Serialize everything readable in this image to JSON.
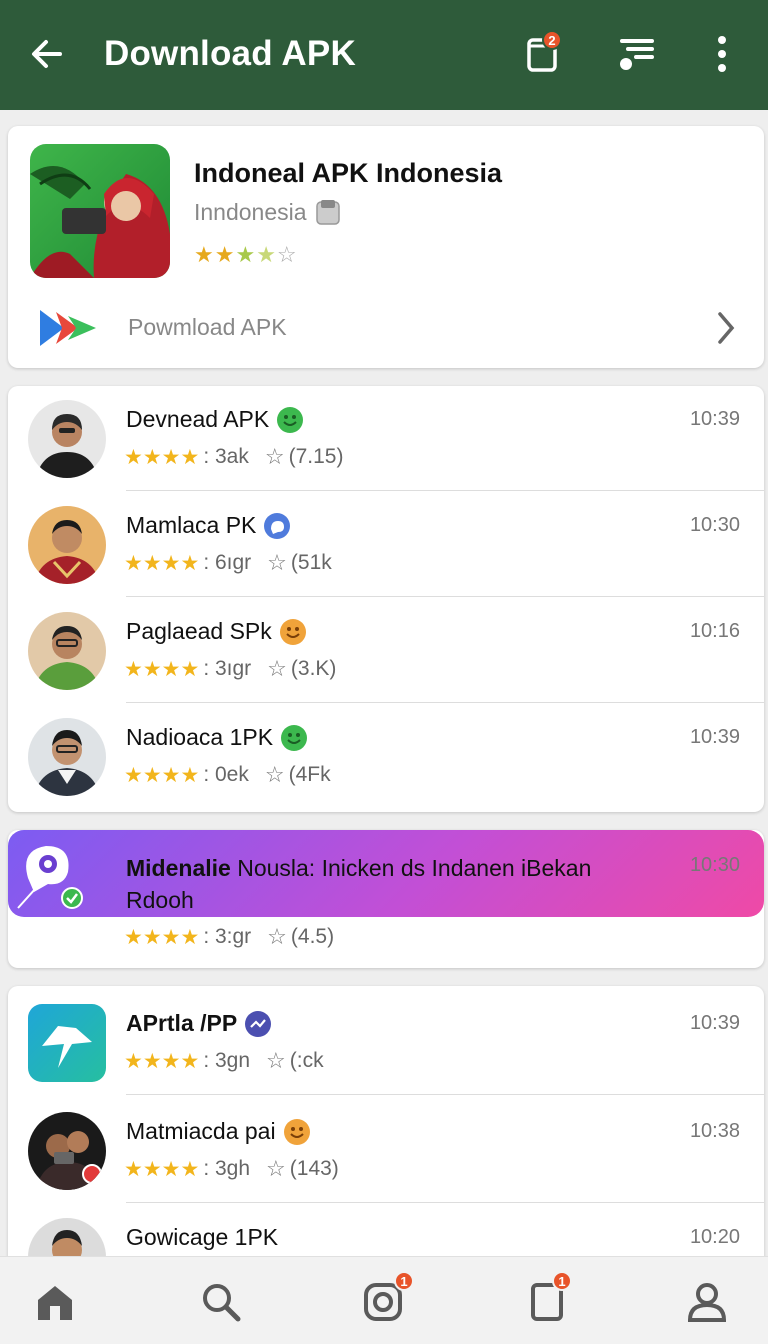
{
  "appbar": {
    "title": "Download APK",
    "cart_badge": "2"
  },
  "featured": {
    "name": "Indoneal APK Indonesia",
    "subtitle": "Inndonesia",
    "rating_stars": 3,
    "download_label": "Powmload APK"
  },
  "list1": [
    {
      "name": "Devnead APK",
      "badge": "green-smile",
      "count": ": 3ak",
      "reviews": "(7.15)",
      "time": "10:39"
    },
    {
      "name": "Mamlaca PK",
      "badge": "blue-chat",
      "count": ": 6ıgr",
      "reviews": "(51k",
      "time": "10:30"
    },
    {
      "name": "Paglaead SPk",
      "badge": "orange-smile",
      "count": ": 3ıgr",
      "reviews": "(3.K)",
      "time": "10:16"
    },
    {
      "name": "Nadioaca 1PK",
      "badge": "green-smile",
      "count": ": 0ek",
      "reviews": "(4Fk",
      "time": "10:39"
    }
  ],
  "promo": {
    "name_bold": "Midenalie",
    "name_rest": " Nousla: Inicken ds Indanen iBekan Rdooh",
    "count": ": 3:gr",
    "reviews": "(4.5)",
    "time": "10:30"
  },
  "list2": [
    {
      "name": "APrtla /PP",
      "badge": "purple-trend",
      "count": ": 3gn",
      "reviews": "(:ck",
      "time": "10:39"
    },
    {
      "name": "Matmiacda pai",
      "badge": "orange-smile",
      "count": ": 3gh",
      "reviews": "(143)",
      "time": "10:38"
    },
    {
      "name": "Gowicage 1PK",
      "badge": "",
      "count": "",
      "reviews": "",
      "time": "10:20"
    }
  ],
  "bottomnav": {
    "items": [
      "home-icon",
      "search-icon",
      "instagram-icon",
      "tablet-icon",
      "profile-icon"
    ],
    "badges": {
      "instagram": "1",
      "tablet": "1"
    }
  },
  "colors": {
    "appbar": "#2e5b3a",
    "star": "#f2b51c",
    "badge": "#e8542a"
  }
}
